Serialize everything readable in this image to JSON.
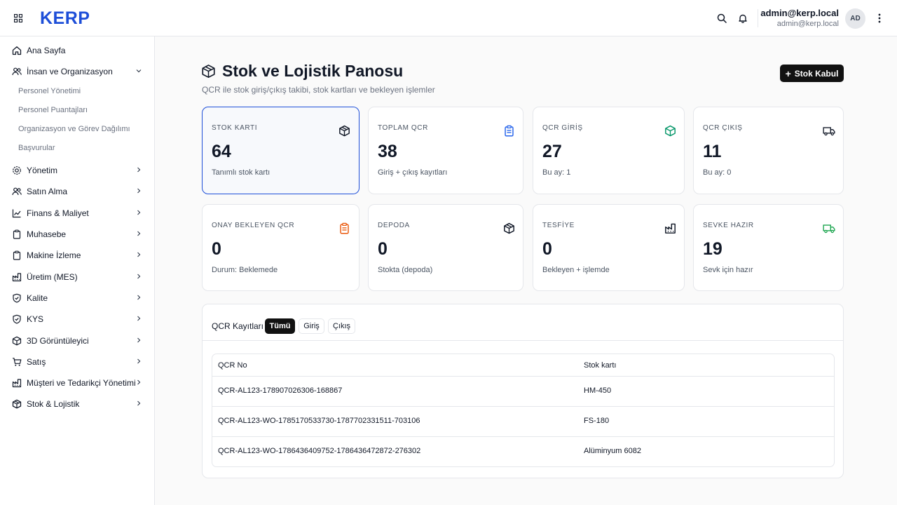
{
  "header": {
    "logo": "KERP",
    "user_name": "admin@kerp.local",
    "user_email": "admin@kerp.local",
    "avatar_initials": "AD"
  },
  "sidebar": {
    "items": [
      {
        "label": "Ana Sayfa",
        "icon": "home-icon"
      },
      {
        "label": "İnsan ve Organizasyon",
        "icon": "users-icon",
        "expanded": true
      },
      {
        "label": "Yönetim",
        "icon": "gear-icon"
      },
      {
        "label": "Satın Alma",
        "icon": "users-icon"
      },
      {
        "label": "Finans & Maliyet",
        "icon": "chart-line-icon"
      },
      {
        "label": "Muhasebe",
        "icon": "clipboard-icon"
      },
      {
        "label": "Makine İzleme",
        "icon": "clipboard-icon"
      },
      {
        "label": "Üretim (MES)",
        "icon": "factory-icon"
      },
      {
        "label": "Kalite",
        "icon": "shield-check-icon"
      },
      {
        "label": "KYS",
        "icon": "shield-check-icon"
      },
      {
        "label": "3D Görüntüleyici",
        "icon": "cube-icon"
      },
      {
        "label": "Satış",
        "icon": "cart-icon"
      },
      {
        "label": "Müşteri ve Tedarikçi Yönetimi",
        "icon": "factory-icon"
      },
      {
        "label": "Stok & Lojistik",
        "icon": "package-icon"
      }
    ],
    "sub_items": [
      "Personel Yönetimi",
      "Personel Puantajları",
      "Organizasyon ve Görev Dağılımı",
      "Başvurular"
    ]
  },
  "page": {
    "title": "Stok ve Lojistik Panosu",
    "subtitle": "QCR ile stok giriş/çıkış takibi, stok kartları ve bekleyen işlemler",
    "primary_button": "Stok Kabul"
  },
  "cards": [
    {
      "label": "STOK KARTI",
      "value": "64",
      "note": "Tanımlı stok kartı",
      "icon": "package-icon",
      "icon_color": "#111827"
    },
    {
      "label": "TOPLAM QCR",
      "value": "38",
      "note": "Giriş + çıkış kayıtları",
      "icon": "clipboard-list-icon",
      "icon_color": "#2563eb"
    },
    {
      "label": "QCR GİRİŞ",
      "value": "27",
      "note": "Bu ay: 1",
      "icon": "package-icon",
      "icon_color": "#059669"
    },
    {
      "label": "QCR ÇIKIŞ",
      "value": "11",
      "note": "Bu ay: 0",
      "icon": "truck-icon",
      "icon_color": "#111827"
    },
    {
      "label": "ONAY BEKLEYEN QCR",
      "value": "0",
      "note": "Durum: Beklemede",
      "icon": "clipboard-list-icon",
      "icon_color": "#ea580c"
    },
    {
      "label": "DEPODA",
      "value": "0",
      "note": "Stokta (depoda)",
      "icon": "package-icon",
      "icon_color": "#111827"
    },
    {
      "label": "TESFİYE",
      "value": "0",
      "note": "Bekleyen + işlemde",
      "icon": "factory-icon",
      "icon_color": "#111827"
    },
    {
      "label": "SEVKE HAZIR",
      "value": "19",
      "note": "Sevk için hazır",
      "icon": "truck-icon",
      "icon_color": "#16a34a"
    }
  ],
  "qcr_panel": {
    "title": "QCR Kayıtları",
    "filters": [
      "Tümü",
      "Giriş",
      "Çıkış"
    ],
    "active_filter": "Tümü",
    "columns": [
      "QCR No",
      "Stok kartı"
    ],
    "rows": [
      [
        "QCR-AL123-178907026306-168867",
        "HM-450"
      ],
      [
        "QCR-AL123-WO-1785170533730-1787702331511-703106",
        "FS-180"
      ],
      [
        "QCR-AL123-WO-1786436409752-1786436472872-276302",
        "Alüminyum 6082"
      ]
    ]
  }
}
